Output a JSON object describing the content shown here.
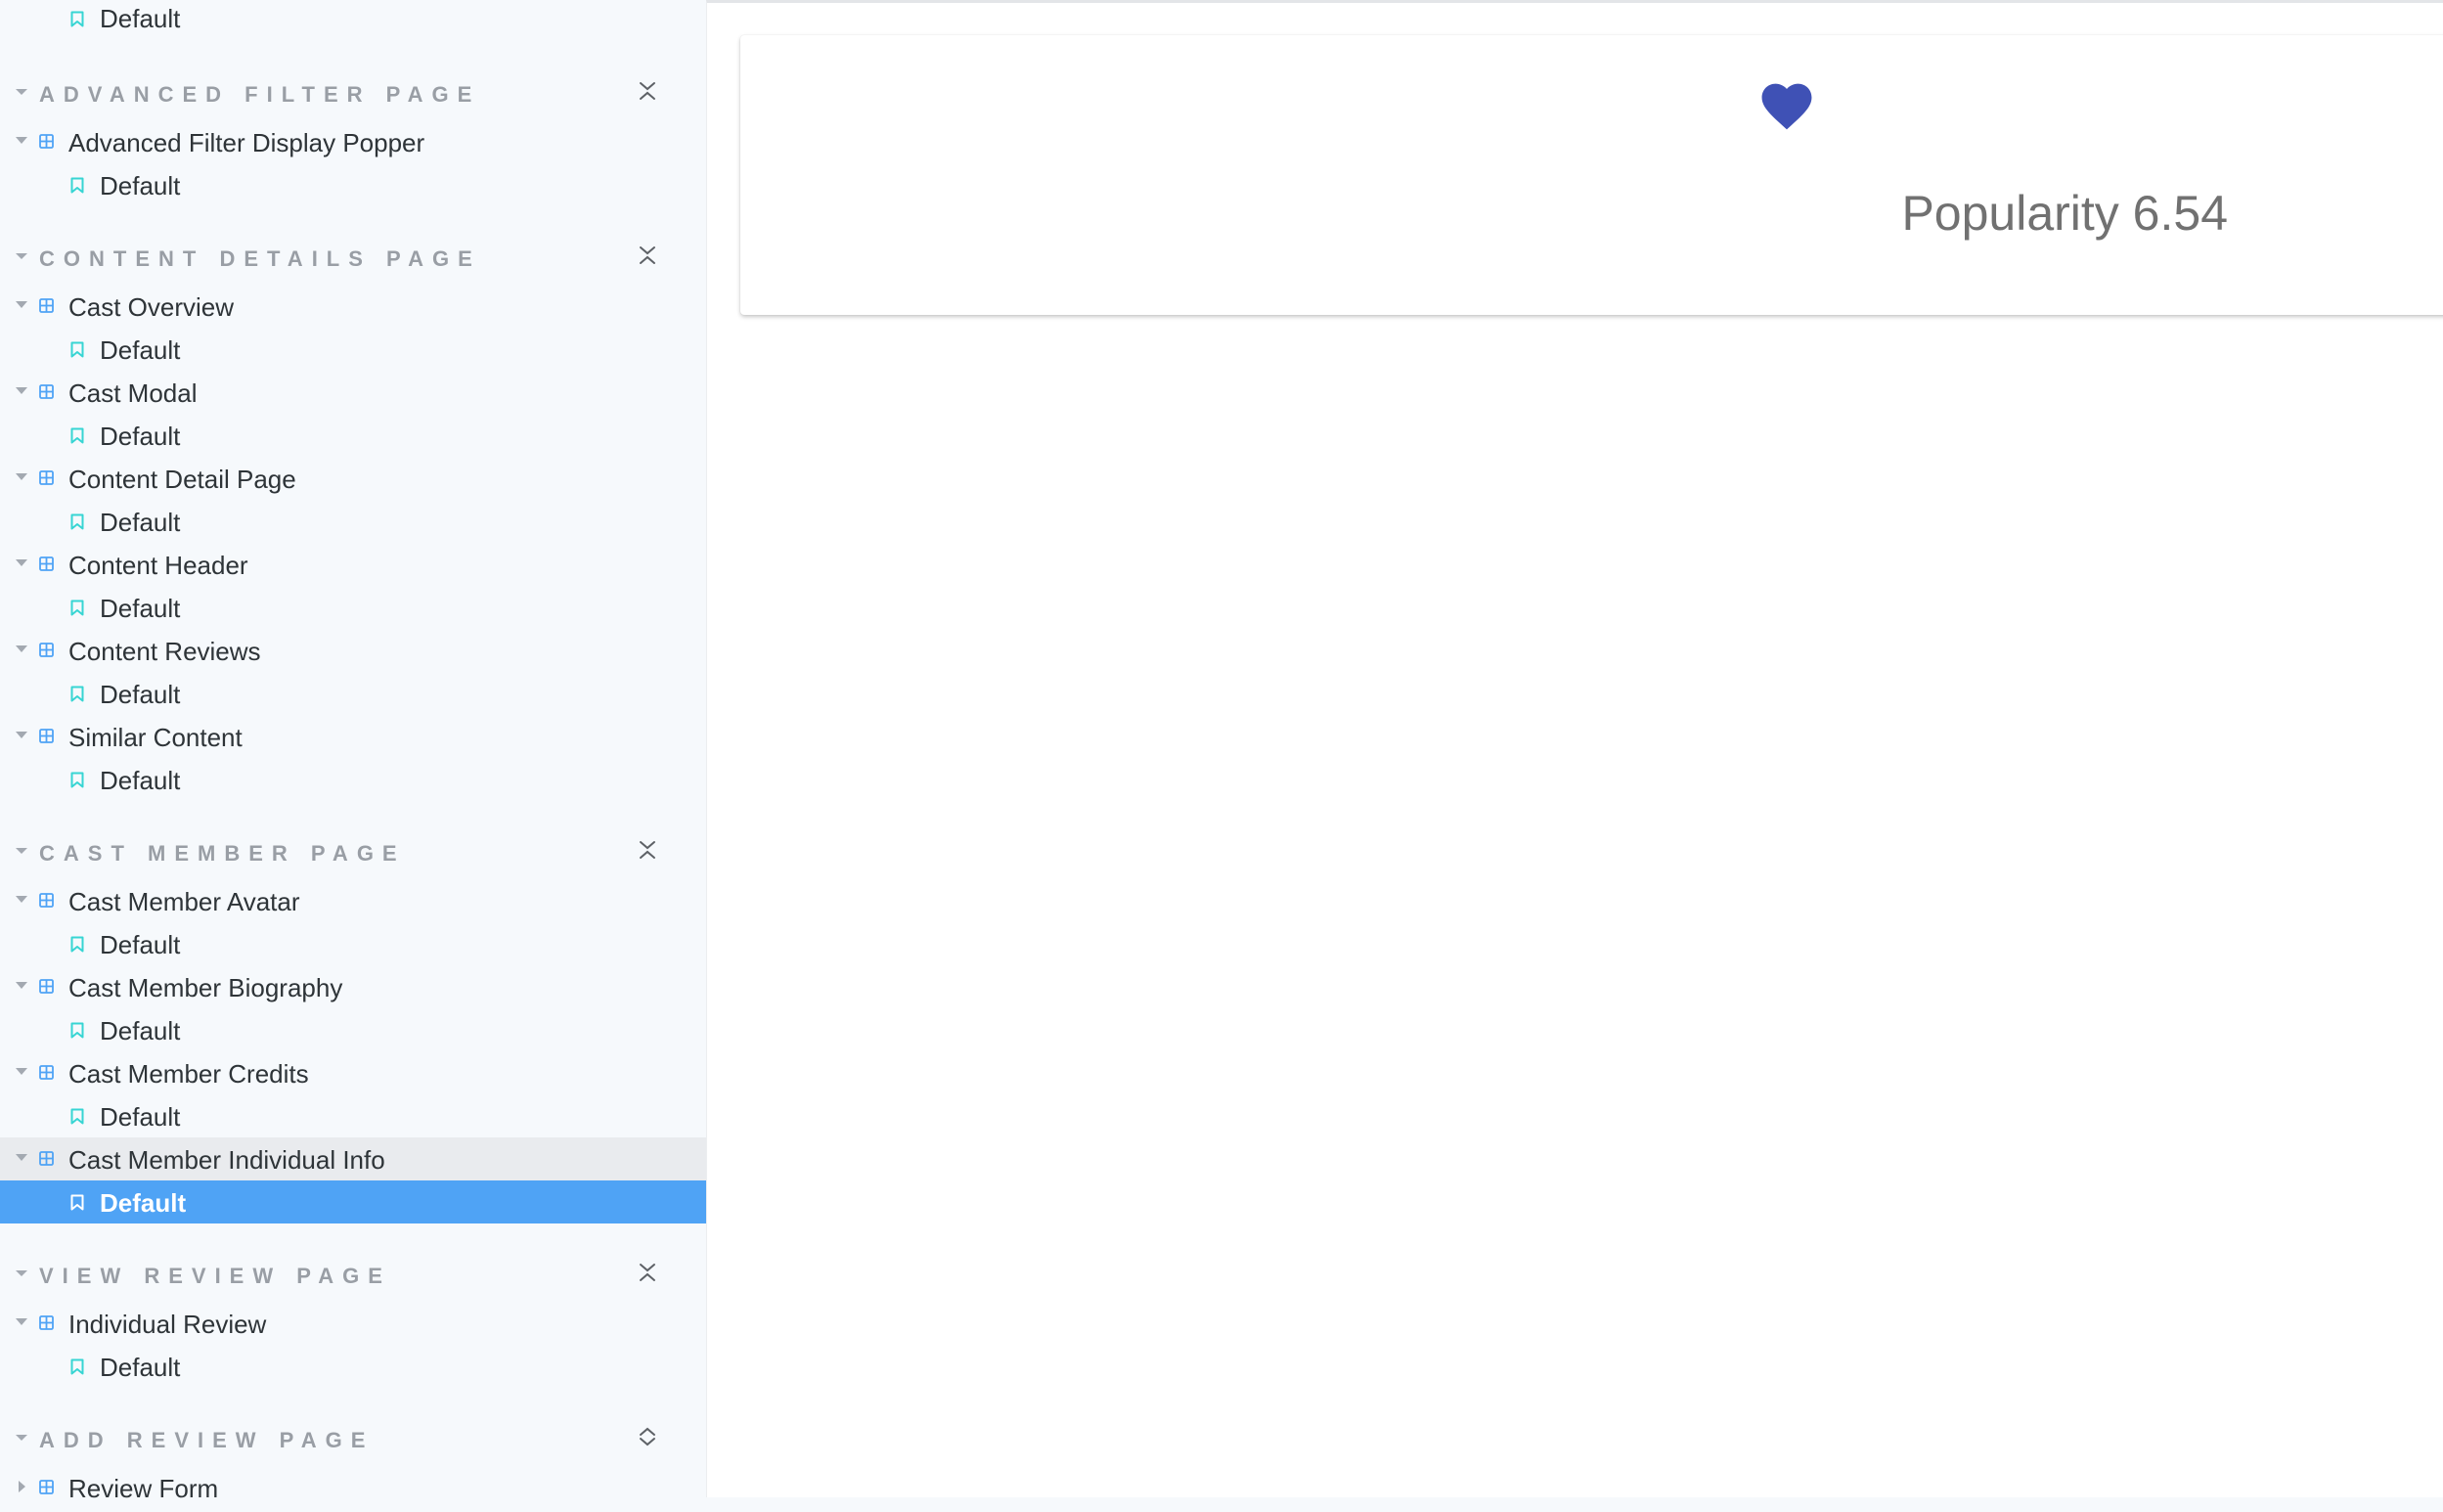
{
  "sidebar": {
    "top_story": "Default",
    "sections": [
      {
        "title": "ADVANCED FILTER PAGE",
        "items": [
          {
            "component": "Advanced Filter Display Popper",
            "story": "Default"
          }
        ]
      },
      {
        "title": "CONTENT DETAILS PAGE",
        "items": [
          {
            "component": "Cast Overview",
            "story": "Default"
          },
          {
            "component": "Cast Modal",
            "story": "Default"
          },
          {
            "component": "Content Detail Page",
            "story": "Default"
          },
          {
            "component": "Content Header",
            "story": "Default"
          },
          {
            "component": "Content Reviews",
            "story": "Default"
          },
          {
            "component": "Similar Content",
            "story": "Default"
          }
        ]
      },
      {
        "title": "CAST MEMBER PAGE",
        "items": [
          {
            "component": "Cast Member Avatar",
            "story": "Default"
          },
          {
            "component": "Cast Member Biography",
            "story": "Default"
          },
          {
            "component": "Cast Member Credits",
            "story": "Default"
          },
          {
            "component": "Cast Member Individual Info",
            "story": "Default",
            "selected": true
          }
        ]
      },
      {
        "title": "VIEW REVIEW PAGE",
        "items": [
          {
            "component": "Individual Review",
            "story": "Default"
          }
        ]
      },
      {
        "title": "ADD REVIEW PAGE",
        "collapsed_icon": true,
        "items": [
          {
            "component": "Review Form",
            "collapsed": true
          }
        ]
      }
    ]
  },
  "preview": {
    "heart_icon": "heart-icon",
    "heart_color": "#3f51b5",
    "popularity_text": "Popularity 6.54"
  },
  "colors": {
    "selected_bg": "#4fa3f5",
    "hover_bg": "#e9ebee",
    "component_icon": "#4fa3f5",
    "story_icon": "#37d5d3"
  }
}
